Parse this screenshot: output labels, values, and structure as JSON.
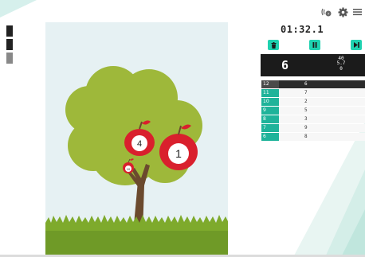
{
  "timer": "01:32.1",
  "controls": {
    "trash_icon": "trash-icon",
    "pause_icon": "pause-icon",
    "skip_icon": "skip-forward-icon"
  },
  "score": {
    "current": "6",
    "stats": [
      "40",
      "5.7",
      "0"
    ]
  },
  "table": [
    {
      "idx": "12",
      "value": "6"
    },
    {
      "idx": "11",
      "value": "7"
    },
    {
      "idx": "10",
      "value": "2"
    },
    {
      "idx": "9",
      "value": "5"
    },
    {
      "idx": "8",
      "value": "3"
    },
    {
      "idx": "7",
      "value": "9"
    },
    {
      "idx": "6",
      "value": "8"
    }
  ],
  "apples": [
    {
      "label": "4"
    },
    {
      "label": "1"
    },
    {
      "label": "10"
    }
  ],
  "colors": {
    "accent": "#1fd2b0",
    "table_index": "#1fb39a",
    "apple": "#d9202d",
    "foliage": "#9eb83a",
    "trunk": "#6b4a2e",
    "grass": "#7eaa2c",
    "sky": "#e6f1f3"
  },
  "top_icons": [
    "sound-wave-icon",
    "gear-icon",
    "menu-icon"
  ]
}
